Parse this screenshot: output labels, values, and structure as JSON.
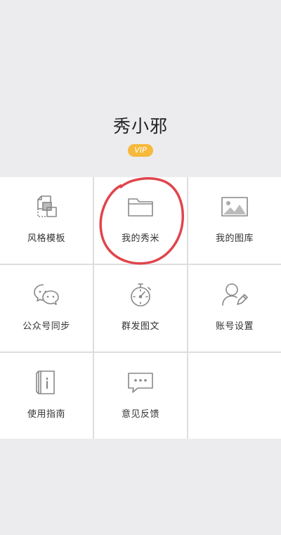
{
  "profile": {
    "username": "秀小邪",
    "badge": "VIP",
    "badge_color": "#f6b93b"
  },
  "menu": {
    "items": [
      {
        "label": "风格模板",
        "icon": "style-template-icon"
      },
      {
        "label": "我的秀米",
        "icon": "folder-icon"
      },
      {
        "label": "我的图库",
        "icon": "image-gallery-icon"
      },
      {
        "label": "公众号同步",
        "icon": "wechat-icon"
      },
      {
        "label": "群发图文",
        "icon": "stopwatch-icon"
      },
      {
        "label": "账号设置",
        "icon": "user-edit-icon"
      },
      {
        "label": "使用指南",
        "icon": "guide-book-icon"
      },
      {
        "label": "意见反馈",
        "icon": "feedback-chat-icon"
      }
    ]
  },
  "annotation_color": "#e0454b"
}
